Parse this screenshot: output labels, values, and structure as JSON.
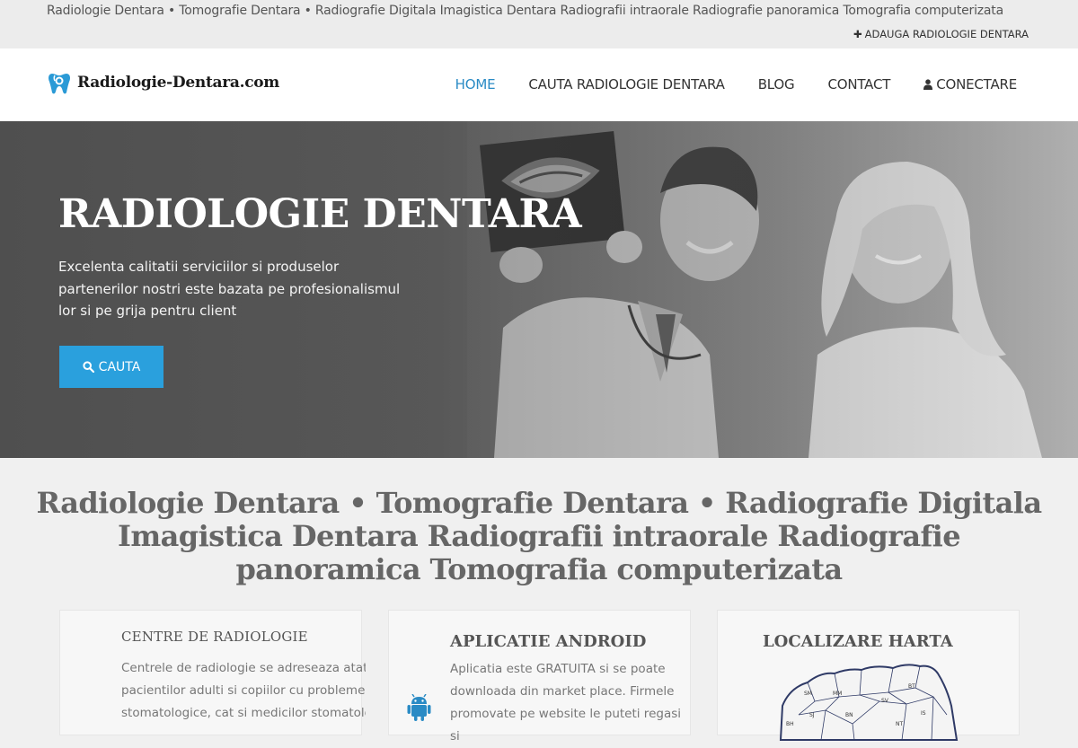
{
  "topbar": {
    "tagline": "Radiologie Dentara • Tomografie Dentara • Radiografie Digitala Imagistica Dentara Radiografii intraorale Radiografie panoramica Tomografia computerizata",
    "add_link": "ADAUGA RADIOLOGIE DENTARA"
  },
  "header": {
    "logo_text": "Radiologie-Dentara.com",
    "nav": [
      {
        "label": "HOME",
        "active": true
      },
      {
        "label": "CAUTA RADIOLOGIE DENTARA"
      },
      {
        "label": "BLOG"
      },
      {
        "label": "CONTACT"
      },
      {
        "label": "CONECTARE"
      }
    ]
  },
  "hero": {
    "title": "RADIOLOGIE DENTARA",
    "text": "Excelenta calitatii serviciilor si produselor partenerilor nostri este bazata pe profesionalismul lor si pe grija pentru client",
    "button_label": "CAUTA"
  },
  "main": {
    "heading": "Radiologie Dentara • Tomografie Dentara • Radiografie Digitala Imagistica Dentara Radiografii intraorale Radiografie panoramica Tomografia computerizata",
    "cards": [
      {
        "title": "CENTRE DE RADIOLOGIE",
        "text_lines": [
          "Centrele de radiologie se adreseaza atat",
          "pacientilor adulti si copiilor cu probleme",
          "stomatologice, cat si medicilor stomatologi"
        ]
      },
      {
        "title": "APLICATIE ANDROID",
        "text_lines": [
          "Aplicatia este GRATUITA si se poate",
          "downloada din market place. Firmele",
          "promovate pe website le puteti regasi si"
        ]
      },
      {
        "title": "LOCALIZARE HARTA",
        "map_labels": [
          "SM",
          "MM",
          "BT",
          "SV",
          "SJ",
          "BH",
          "BN",
          "NT",
          "IS"
        ]
      }
    ]
  },
  "colors": {
    "accent": "#2aa0dd",
    "nav_active": "#2a8bc5",
    "topbar_bg": "#ececec"
  },
  "icons": [
    "plus-icon",
    "tooth-logo-icon",
    "user-icon",
    "search-icon",
    "android-icon",
    "romania-map"
  ]
}
